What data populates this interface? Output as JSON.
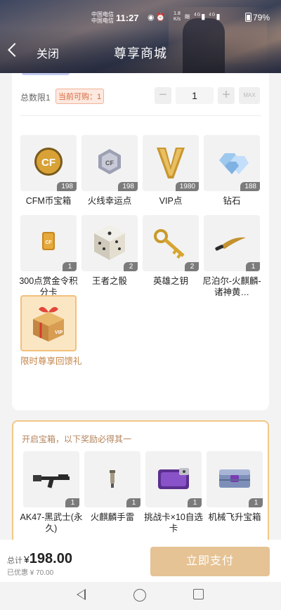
{
  "status_bar": {
    "carrier_1": "中国电信",
    "carrier_2": "中国电信",
    "time": "11:27",
    "net_speed": "1.8",
    "net_unit": "K/s",
    "signal_1": "4G",
    "signal_2": "4G",
    "battery": "79%"
  },
  "nav": {
    "back_label": "关闭",
    "title": "尊享商城"
  },
  "purchase": {
    "total_limit": "总数限1",
    "can_buy": "当前可购：1",
    "quantity": "1",
    "minus": "−",
    "plus": "+",
    "max": "MAX"
  },
  "items": [
    {
      "name": "CFM币宝箱",
      "count": "198",
      "icon": "cfm-coin-icon"
    },
    {
      "name": "火线幸运点",
      "count": "198",
      "icon": "lucky-point-icon"
    },
    {
      "name": "VIP点",
      "count": "1980",
      "icon": "vip-point-icon"
    },
    {
      "name": "钻石",
      "count": "188",
      "icon": "diamond-icon"
    },
    {
      "name": "300点赏金令积分卡",
      "count": "1",
      "icon": "bounty-card-icon"
    },
    {
      "name": "王者之骰",
      "count": "2",
      "icon": "dice-icon"
    },
    {
      "name": "英雄之钥",
      "count": "2",
      "icon": "key-icon"
    },
    {
      "name": "尼泊尔-火麒麟-诸神黄…",
      "count": "1",
      "icon": "knife-icon"
    },
    {
      "name": "限时尊享回馈礼",
      "icon": "gift-box-icon"
    }
  ],
  "chest": {
    "heading": "开启宝箱，以下奖励必得其一",
    "rewards": [
      {
        "name": "AK47-黑武士(永久)",
        "count": "1",
        "icon": "rifle-icon"
      },
      {
        "name": "火麒麟手雷",
        "count": "1",
        "icon": "grenade-icon"
      },
      {
        "name": "挑战卡×10自选卡",
        "count": "1",
        "icon": "challenge-card-icon"
      },
      {
        "name": "机械飞升宝箱",
        "count": "1",
        "icon": "mech-chest-icon"
      }
    ]
  },
  "footer": {
    "total_label": "总计",
    "currency": "¥",
    "price": "198.00",
    "discount": "已优惠 ¥ 70.00",
    "pay_label": "立即支付"
  }
}
